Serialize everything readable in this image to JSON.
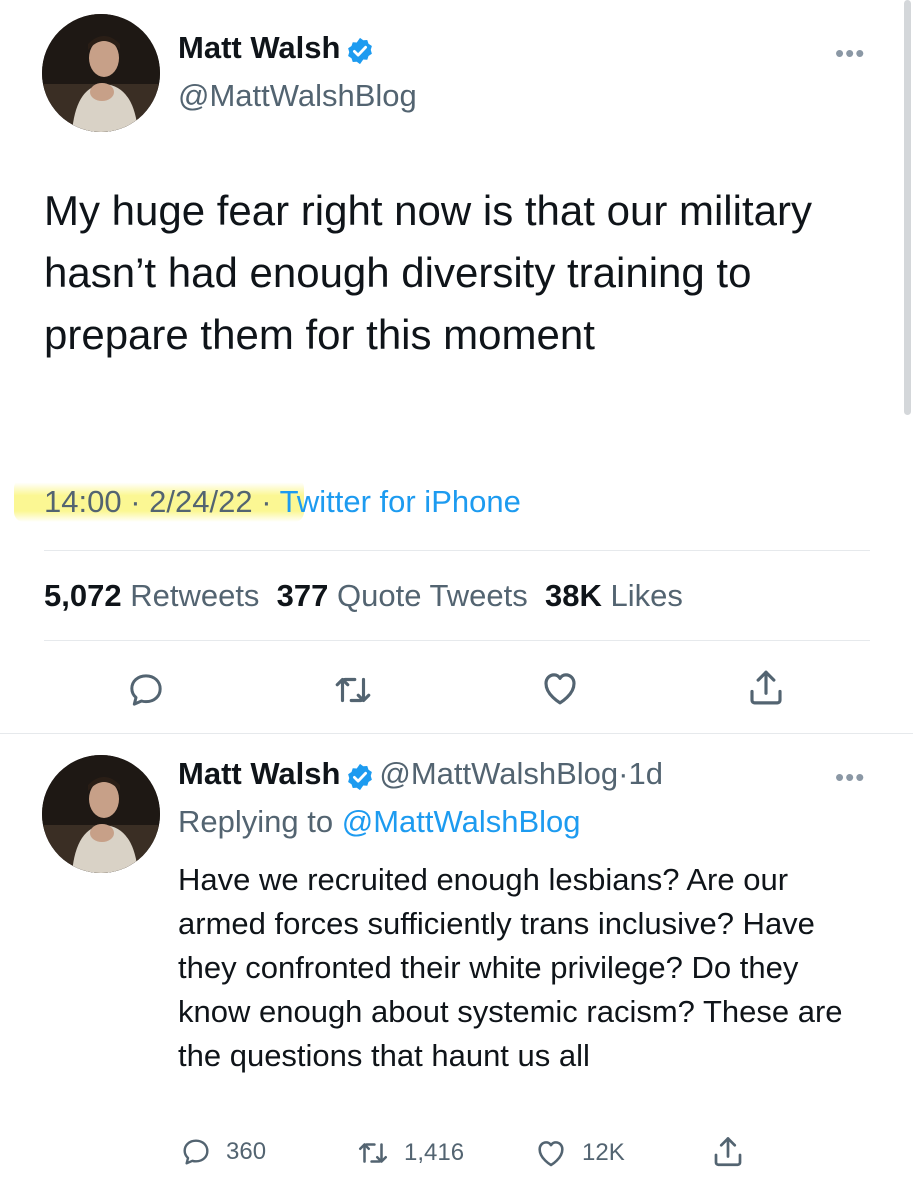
{
  "main_tweet": {
    "author_name": "Matt Walsh",
    "author_handle": "@MattWalshBlog",
    "more_label": "•••",
    "text": "My huge fear right now is that our military hasn’t had enough diversity training to prepare them for this moment",
    "time": "14:00",
    "separator": "·",
    "date": "2/24/22",
    "source": "Twitter for iPhone",
    "stats": {
      "retweets_count": "5,072",
      "retweets_label": "Retweets",
      "quotes_count": "377",
      "quotes_label": "Quote Tweets",
      "likes_count": "38K",
      "likes_label": "Likes"
    },
    "actions": [
      "reply-icon",
      "retweet-icon",
      "like-icon",
      "share-icon"
    ]
  },
  "reply_tweet": {
    "author_name": "Matt Walsh",
    "author_handle": "@MattWalshBlog",
    "time_ago": "1d",
    "separator": "·",
    "more_label": "•••",
    "replying_prefix": "Replying to",
    "replying_to": "@MattWalshBlog",
    "text": "Have we recruited enough lesbians? Are our armed forces sufficiently trans inclusive? Have they confronted their white privilege? Do they know enough about systemic racism? These are the questions that haunt us all",
    "reply_count": "360",
    "retweet_count": "1,416",
    "like_count": "12K"
  },
  "colors": {
    "accent": "#1d9bf0",
    "text": "#0f1419",
    "secondary": "#536471",
    "highlight": "#f6f27a"
  }
}
